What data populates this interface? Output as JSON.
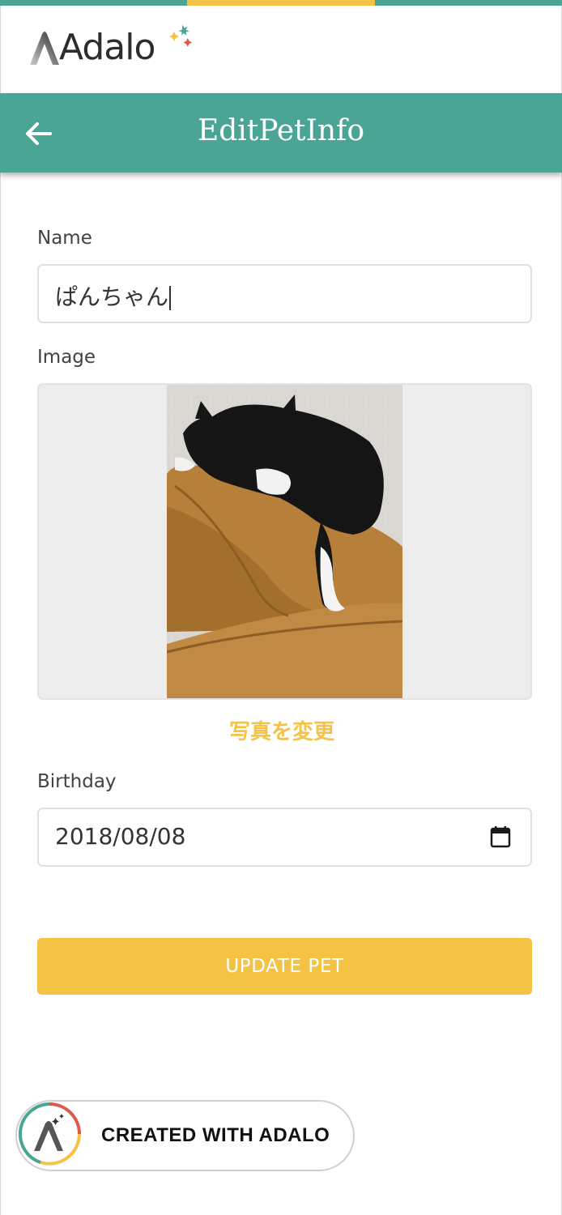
{
  "progress_bar": {
    "colors": [
      "#4aa594",
      "#f4c343",
      "#4aa594"
    ],
    "label": "loading-progress"
  },
  "brand": {
    "logo_text": "Adalo",
    "star_colors": [
      "#f4c343",
      "#4aa594",
      "#e0574c"
    ]
  },
  "appbar": {
    "title": "EditPetInfo",
    "back_icon": "arrow-left-icon",
    "color": "#4aa594"
  },
  "form": {
    "name_label": "Name",
    "name_value": "ぱんちゃん",
    "image_label": "Image",
    "image_description": "black-and-white cat sleeping on a tan leather sofa",
    "change_photo_label": "写真を変更",
    "birthday_label": "Birthday",
    "birthday_value": "2018/08/08",
    "calendar_icon": "calendar-icon",
    "submit_label": "UPDATE PET"
  },
  "badge": {
    "label": "CREATED WITH ADALO",
    "ring_colors": [
      "#e0574c",
      "#f4c343",
      "#4aa594"
    ]
  },
  "colors": {
    "primary": "#4aa594",
    "accent": "#f4c343",
    "text": "#424242"
  }
}
